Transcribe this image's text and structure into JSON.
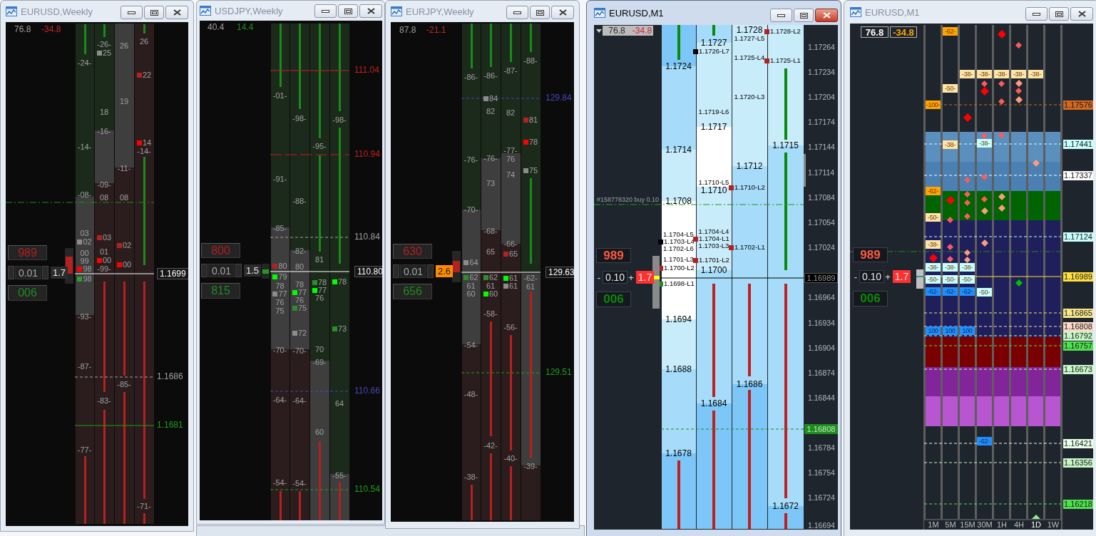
{
  "windows": [
    {
      "kind": "weekly",
      "title": "EURUSD,Weekly",
      "active": false,
      "readings": [
        {
          "text": "76.8",
          "color": "#a0a0a0"
        },
        {
          "text": "-34.8",
          "color": "#c8282a"
        }
      ],
      "sell_price": "989",
      "lot": "0.01",
      "spread": {
        "text": "1.7",
        "color": "#2c2c2c"
      },
      "buy_price": "006",
      "candle": {
        "color": "#b52020"
      },
      "columns": [
        {
          "labels": [
            {
              "text": "-24-"
            },
            {
              "text": "-14-"
            },
            {
              "text": "-08-"
            },
            {
              "text": "03"
            },
            {
              "text": "02",
              "color": "#8c8c8c"
            },
            {
              "text": "00"
            },
            {
              "text": "99"
            },
            {
              "text": "98",
              "color": "#ff0000"
            },
            {
              "text": "98",
              "color": "#2e9e2e"
            },
            {
              "text": "-93-"
            },
            {
              "text": "-87-"
            },
            {
              "text": "-77-"
            }
          ]
        },
        {
          "labels": [
            {
              "text": "-26-"
            },
            {
              "text": "25",
              "color": "#8c8c8c"
            },
            {
              "text": "18"
            },
            {
              "text": "-16-"
            },
            {
              "text": "-09-"
            },
            {
              "text": "08"
            },
            {
              "text": "03",
              "color": "#b22222"
            },
            {
              "text": "01"
            },
            {
              "text": "00",
              "color": "#ff0000"
            },
            {
              "text": "-99-"
            },
            {
              "text": "-83-"
            }
          ]
        },
        {
          "labels": [
            {
              "text": "26"
            },
            {
              "text": "19"
            },
            {
              "text": "-11-"
            },
            {
              "text": "08"
            },
            {
              "text": "02",
              "color": "#b22222"
            },
            {
              "text": "00",
              "color": "#ff0000"
            },
            {
              "text": "-85-"
            }
          ]
        },
        {
          "labels": [
            {
              "text": "26"
            },
            {
              "text": "22",
              "color": "#b22222"
            },
            {
              "text": "14",
              "color": "#ff0000"
            },
            {
              "text": "-14-"
            },
            {
              "text": "-71-"
            }
          ]
        }
      ],
      "price_labels": [
        {
          "text": "1.1699",
          "color": "#ffffff",
          "kind": "current"
        },
        {
          "text": "1.1686",
          "color": "#a0a0a0",
          "kind": "level"
        },
        {
          "text": "1.1681",
          "color": "#1e9e1e",
          "kind": "level"
        }
      ]
    },
    {
      "kind": "weekly",
      "title": "USDJPY,Weekly",
      "active": false,
      "readings": [
        {
          "text": "40.4",
          "color": "#a0a0a0"
        },
        {
          "text": "14.4",
          "color": "#1e8c1e"
        }
      ],
      "sell_price": "800",
      "lot": "0.01",
      "spread": {
        "text": "1.5",
        "color": "#2c2c2c"
      },
      "buy_price": "815",
      "candle": {
        "color": "#1e9e1e"
      },
      "columns": [
        {
          "labels": [
            {
              "text": "-01-"
            },
            {
              "text": "-91-"
            },
            {
              "text": "-85-"
            },
            {
              "text": "80",
              "color": "#b22222"
            },
            {
              "text": "79",
              "color": "#00ff00"
            },
            {
              "text": "78"
            },
            {
              "text": "77",
              "color": "#8c8c8c"
            },
            {
              "text": "76"
            },
            {
              "text": "75"
            },
            {
              "text": "-70-"
            },
            {
              "text": "-64-"
            },
            {
              "text": "-54-"
            }
          ]
        },
        {
          "labels": [
            {
              "text": "-98-"
            },
            {
              "text": "-88-"
            },
            {
              "text": "-82-"
            },
            {
              "text": "80"
            },
            {
              "text": "78"
            },
            {
              "text": "77",
              "color": "#00ff00"
            },
            {
              "text": "76"
            },
            {
              "text": "75",
              "color": "#2e8b2e"
            },
            {
              "text": "72",
              "color": "#8c8c8c"
            },
            {
              "text": "-70-"
            },
            {
              "text": "-64-"
            },
            {
              "text": "-54-"
            }
          ]
        },
        {
          "labels": [
            {
              "text": "-95-"
            },
            {
              "text": "81"
            },
            {
              "text": "78",
              "color": "#2e8b2e"
            },
            {
              "text": "77",
              "color": "#00ff00"
            },
            {
              "text": "76"
            },
            {
              "text": "70"
            },
            {
              "text": "-69-"
            },
            {
              "text": "60"
            }
          ]
        },
        {
          "labels": [
            {
              "text": "-98-"
            },
            {
              "text": "78",
              "color": "#00ff00"
            },
            {
              "text": "73",
              "color": "#2e8b2e"
            },
            {
              "text": "64"
            },
            {
              "text": "-55-"
            }
          ]
        }
      ],
      "price_labels": [
        {
          "text": "111.04",
          "color": "#c02020",
          "kind": "level"
        },
        {
          "text": "110.94",
          "color": "#c02020",
          "kind": "level"
        },
        {
          "text": "110.84",
          "color": "#a0a0a0",
          "kind": "level"
        },
        {
          "text": "110.80",
          "color": "#ffffff",
          "kind": "current"
        },
        {
          "text": "110.66",
          "color": "#4646b4",
          "kind": "level"
        },
        {
          "text": "110.54",
          "color": "#1e9e1e",
          "kind": "level"
        }
      ]
    },
    {
      "kind": "weekly",
      "title": "EURJPY,Weekly",
      "active": false,
      "readings": [
        {
          "text": "87.8",
          "color": "#a0a0a0"
        },
        {
          "text": "-21.1",
          "color": "#c8282a"
        }
      ],
      "sell_price": "630",
      "lot": "0.01",
      "spread": {
        "text": "2.6",
        "color": "#ff8c00"
      },
      "buy_price": "656",
      "candle": {
        "color": "#b52020"
      },
      "columns": [
        {
          "labels": [
            {
              "text": "-86-"
            },
            {
              "text": "-76-"
            },
            {
              "text": "-70-"
            },
            {
              "text": "64",
              "color": "#8c8c8c"
            },
            {
              "text": "62",
              "color": "#2e8b2e"
            },
            {
              "text": "61"
            },
            {
              "text": "60"
            },
            {
              "text": "-54-"
            },
            {
              "text": "-48-"
            },
            {
              "text": "-38-"
            }
          ]
        },
        {
          "labels": [
            {
              "text": "-86-"
            },
            {
              "text": "84",
              "color": "#8c8c8c"
            },
            {
              "text": "82"
            },
            {
              "text": "-76-"
            },
            {
              "text": "73"
            },
            {
              "text": "-68-"
            },
            {
              "text": "65"
            },
            {
              "text": "62",
              "color": "#2e8b2e"
            },
            {
              "text": "61"
            },
            {
              "text": "60",
              "color": "#00ff00"
            },
            {
              "text": "-58-"
            },
            {
              "text": "-42-"
            }
          ]
        },
        {
          "labels": [
            {
              "text": "-87-"
            },
            {
              "text": "82"
            },
            {
              "text": "-77-"
            },
            {
              "text": "76"
            },
            {
              "text": "74"
            },
            {
              "text": "-66-"
            },
            {
              "text": "65",
              "color": "#b22222"
            },
            {
              "text": "61",
              "color": "#00ff00"
            },
            {
              "text": "61",
              "color": "#8c8c8c"
            },
            {
              "text": "-56-"
            },
            {
              "text": "-40-"
            }
          ]
        },
        {
          "labels": [
            {
              "text": "-88-"
            },
            {
              "text": "81",
              "color": "#b22222"
            },
            {
              "text": "78",
              "color": "#ff0000"
            },
            {
              "text": "75",
              "color": "#8c8c8c"
            },
            {
              "text": "-62-"
            },
            {
              "text": "61"
            },
            {
              "text": "-39-"
            }
          ]
        }
      ],
      "price_labels": [
        {
          "text": "129.84",
          "color": "#4646b4",
          "kind": "level"
        },
        {
          "text": "129.63",
          "color": "#ffffff",
          "kind": "current"
        },
        {
          "text": "129.51",
          "color": "#1e9e1e",
          "kind": "level"
        }
      ]
    },
    {
      "kind": "ladder",
      "title": "EURUSD,M1",
      "active": true,
      "readings": [
        {
          "text": "76.8",
          "color": "#2a2a2a"
        },
        {
          "text": "-34.8",
          "color": "#c8282a"
        }
      ],
      "sell_price": "989",
      "lot": "0.10",
      "lot_buttons": [
        "-",
        "+"
      ],
      "spread": {
        "text": "1.7",
        "color": "#ff3030"
      },
      "buy_price": "006",
      "order_label": "#158778320 buy 0.10",
      "columns": [
        {
          "labels": [
            {
              "text": "1.1724",
              "kind": "major"
            },
            {
              "text": "1.1714",
              "kind": "major"
            },
            {
              "text": "1.1708",
              "kind": "major"
            },
            {
              "text": "1.1704-L5",
              "kind": "minor"
            },
            {
              "text": "1.1703-L4",
              "kind": "minor",
              "color": "#000000"
            },
            {
              "text": "1.1702-L6",
              "kind": "minor"
            },
            {
              "text": "1.1701-L3",
              "kind": "minor"
            },
            {
              "text": "1.1700-L2",
              "kind": "minor",
              "color": "#b22222"
            },
            {
              "text": "1.1698-L1",
              "kind": "minor",
              "color": "#228b22"
            },
            {
              "text": "1.1694",
              "kind": "major"
            },
            {
              "text": "1.1688",
              "kind": "major"
            },
            {
              "text": "1.1678",
              "kind": "major"
            }
          ]
        },
        {
          "labels": [
            {
              "text": "1.1727",
              "kind": "major"
            },
            {
              "text": "1.1726-L7",
              "kind": "minor",
              "color": "#000000"
            },
            {
              "text": "1.1719-L6",
              "kind": "minor"
            },
            {
              "text": "1.1717",
              "kind": "major"
            },
            {
              "text": "1.1710-L5",
              "kind": "minor"
            },
            {
              "text": "1.1710",
              "kind": "major"
            },
            {
              "text": "1.1704-L4",
              "kind": "minor"
            },
            {
              "text": "1.1704-L1",
              "kind": "minor",
              "color": "#b22222"
            },
            {
              "text": "1.1703-L3",
              "kind": "minor"
            },
            {
              "text": "1.1701-L2",
              "kind": "minor",
              "color": "#b22222"
            },
            {
              "text": "1.1700",
              "kind": "major"
            },
            {
              "text": "1.1684",
              "kind": "major"
            }
          ]
        },
        {
          "labels": [
            {
              "text": "1.1728",
              "kind": "major"
            },
            {
              "text": "1.1727-L5",
              "kind": "minor"
            },
            {
              "text": "1.1725-L4",
              "kind": "minor"
            },
            {
              "text": "1.1720-L3",
              "kind": "minor"
            },
            {
              "text": "1.1712",
              "kind": "major"
            },
            {
              "text": "1.1710-L2",
              "kind": "minor",
              "color": "#b22222"
            },
            {
              "text": "1.1702-L1",
              "kind": "minor",
              "color": "#b22222"
            },
            {
              "text": "1.1686",
              "kind": "major"
            }
          ]
        },
        {
          "labels": [
            {
              "text": "1.1728-L2",
              "kind": "minor",
              "color": "#b22222"
            },
            {
              "text": "1.1725-L1",
              "kind": "minor",
              "color": "#b22222"
            },
            {
              "text": "1.1715",
              "kind": "major"
            },
            {
              "text": "1.1672",
              "kind": "major"
            }
          ]
        }
      ],
      "axis_ticks": [
        "1.17264",
        "1.17234",
        "1.17204",
        "1.17174",
        "1.17144",
        "1.17114",
        "1.17084",
        "1.17054",
        "1.17024",
        "1.16964",
        "1.16934",
        "1.16904",
        "1.16874",
        "1.16844",
        "1.16784",
        "1.16754",
        "1.16724",
        "1.16694"
      ],
      "price_labels": [
        {
          "text": "1.16989",
          "color": "#000000",
          "kind": "current"
        },
        {
          "text": "1.16808",
          "color": "#1e8c1e",
          "kind": "level"
        }
      ]
    },
    {
      "kind": "matrix",
      "title": "EURUSD,M1",
      "active": false,
      "readings": [
        {
          "text": "76.8",
          "color": "#ffffff"
        },
        {
          "text": "-34.8",
          "color": "#ffa500"
        }
      ],
      "sell_price": "989",
      "lot": "0.10",
      "lot_buttons": [
        "-",
        "+"
      ],
      "spread": {
        "text": "1.7",
        "color": "#ff3030"
      },
      "buy_price": "006",
      "columns": [
        {
          "label": "1M",
          "selected": false,
          "tags": [
            {
              "text": "-100-",
              "color": "#ffa500"
            },
            {
              "text": "-62-",
              "color": "#ffa500"
            },
            {
              "text": "-50-",
              "color": "#ffe4a8"
            },
            {
              "text": "-38-",
              "color": "#ffe4a8"
            },
            {
              "text": "-38-",
              "color": "#c8ffff"
            },
            {
              "text": "-50-",
              "color": "#c8ffff"
            },
            {
              "text": "-62-",
              "color": "#1e90ff"
            },
            {
              "text": "100",
              "color": "#1e90ff"
            }
          ],
          "markers": [
            {
              "color": "#ff0000"
            }
          ]
        },
        {
          "label": "5M",
          "selected": false,
          "tags": [
            {
              "text": "-62-",
              "color": "#ffa500"
            },
            {
              "text": "-50-",
              "color": "#ffe4a8"
            },
            {
              "text": "-38-",
              "color": "#ffe4a8"
            },
            {
              "text": "-38-",
              "color": "#c8ffff"
            },
            {
              "text": "-50-",
              "color": "#c8ffff"
            },
            {
              "text": "-62-",
              "color": "#1e90ff"
            },
            {
              "text": "100",
              "color": "#1e90ff"
            }
          ],
          "markers": [
            {
              "color": "#ff0000"
            },
            {
              "color": "#ff5a5a"
            },
            {
              "color": "#ff5a5a"
            },
            {
              "color": "#ff5a5a"
            }
          ]
        },
        {
          "label": "15M",
          "selected": false,
          "tags": [
            {
              "text": "-38-",
              "color": "#ffe4a8"
            },
            {
              "text": "-38-",
              "color": "#c8ffff"
            },
            {
              "text": "-50-",
              "color": "#c8ffff"
            },
            {
              "text": "-62-",
              "color": "#1e90ff"
            },
            {
              "text": "100",
              "color": "#1e90ff"
            }
          ],
          "markers": [
            {
              "color": "#ff0000"
            },
            {
              "color": "#ff5a5a"
            },
            {
              "color": "#ff5a5a"
            },
            {
              "color": "#ff5a5a"
            },
            {
              "color": "#ff5a5a"
            },
            {
              "color": "#ff9a80"
            },
            {
              "color": "#ff9a80"
            }
          ]
        },
        {
          "label": "30M",
          "selected": false,
          "tags": [
            {
              "text": "-38-",
              "color": "#ffe4a8"
            },
            {
              "text": "-38-",
              "color": "#c8ffff"
            },
            {
              "text": "-50-",
              "color": "#c8ffff"
            },
            {
              "text": "-62-",
              "color": "#1e90ff"
            }
          ],
          "markers": [
            {
              "color": "#ff5a5a"
            },
            {
              "color": "#ff0000"
            },
            {
              "color": "#ff5a5a"
            },
            {
              "color": "#ff5a5a"
            },
            {
              "color": "#ff5a5a"
            },
            {
              "color": "#ff9a80"
            },
            {
              "color": "#ff9a80"
            }
          ]
        },
        {
          "label": "1H",
          "selected": false,
          "tags": [
            {
              "text": "-38-",
              "color": "#ffe4a8"
            }
          ],
          "markers": [
            {
              "color": "#ff0000"
            },
            {
              "color": "#ff5a5a"
            },
            {
              "color": "#ff5a5a"
            },
            {
              "color": "#ff5a5a"
            },
            {
              "color": "#ff9a80"
            },
            {
              "color": "#ff9a80"
            }
          ]
        },
        {
          "label": "4H",
          "selected": false,
          "tags": [
            {
              "text": "-38-",
              "color": "#ffe4a8"
            }
          ],
          "markers": [
            {
              "color": "#ff5a5a"
            },
            {
              "color": "#ff9a80"
            },
            {
              "color": "#ff5a5a"
            },
            {
              "color": "#ff9a80"
            },
            {
              "color": "#00c000"
            }
          ]
        },
        {
          "label": "1D",
          "selected": true,
          "tags": [
            {
              "text": "-38-",
              "color": "#ffe4a8"
            }
          ],
          "markers": [
            {
              "color": "#ff9a80"
            }
          ]
        },
        {
          "label": "1W",
          "selected": false
        }
      ],
      "price_labels": [
        {
          "text": "1.17576",
          "color": "#d2691e",
          "kind": "level"
        },
        {
          "text": "1.17441",
          "color": "#c8ffff",
          "kind": "level"
        },
        {
          "text": "1.17337",
          "color": "#ffffff",
          "kind": "level"
        },
        {
          "text": "1.17124",
          "color": "#c8ffff",
          "kind": "level"
        },
        {
          "text": "1.16989",
          "color": "#ffe040",
          "kind": "current"
        },
        {
          "text": "1.16865",
          "color": "#f5e68c",
          "kind": "level"
        },
        {
          "text": "1.16808",
          "color": "#ffd8c8",
          "kind": "level"
        },
        {
          "text": "1.16792",
          "color": "#c8f5c8",
          "kind": "level"
        },
        {
          "text": "1.16757",
          "color": "#50e050",
          "kind": "level"
        },
        {
          "text": "1.16673",
          "color": "#c8f5c8",
          "kind": "level"
        },
        {
          "text": "1.16421",
          "color": "#e8ffe8",
          "kind": "level"
        },
        {
          "text": "1.16356",
          "color": "#c8f5c8",
          "kind": "level"
        },
        {
          "text": "1.16218",
          "color": "#50e050",
          "kind": "level"
        }
      ]
    }
  ]
}
